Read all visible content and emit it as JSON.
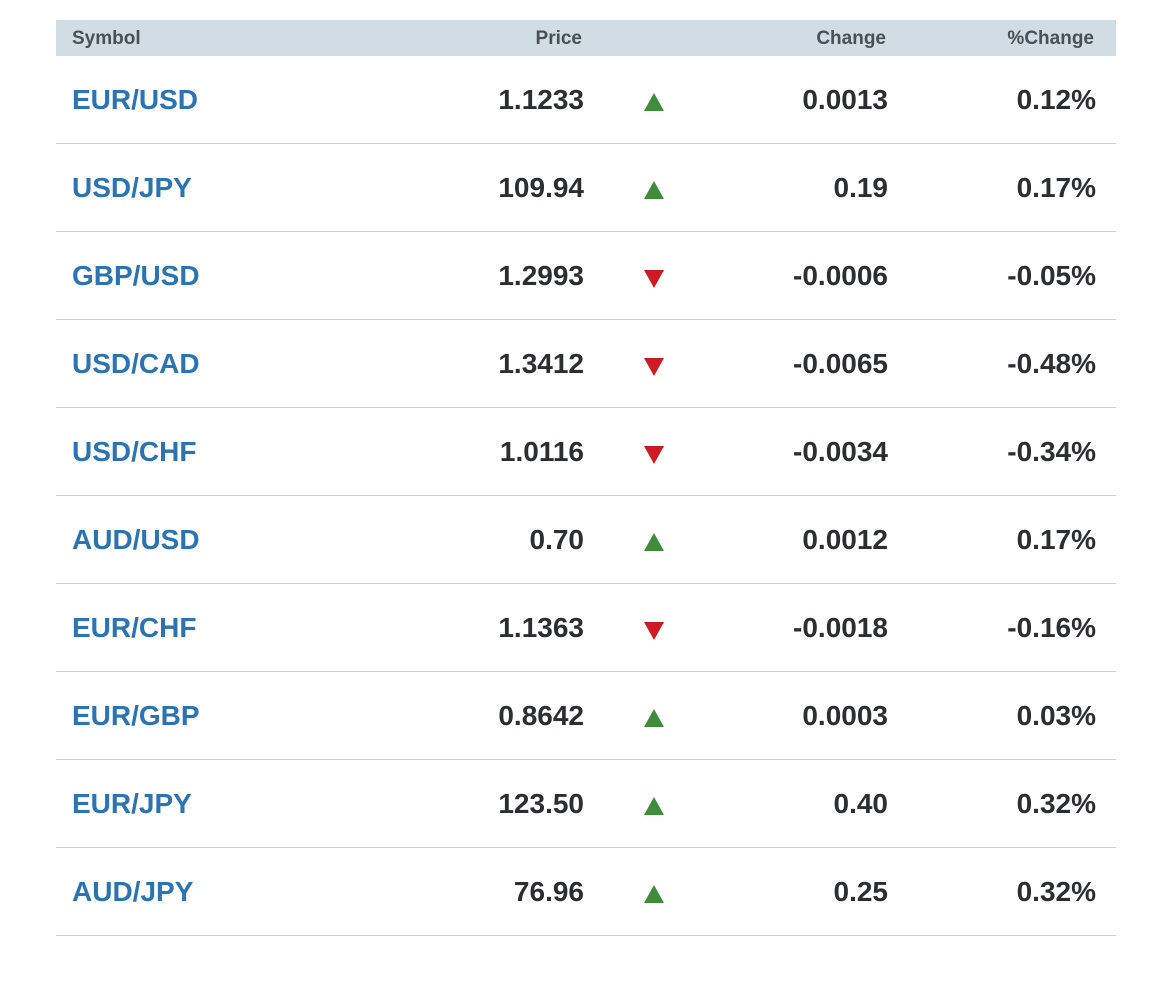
{
  "colors": {
    "header_bg": "#d1dde4",
    "symbol_link": "#2c73b4",
    "up": "#3f8d3a",
    "down": "#cc1b24",
    "divider": "#c9d3d9"
  },
  "header": {
    "symbol": "Symbol",
    "price": "Price",
    "change": "Change",
    "pct_change": "%Change"
  },
  "rows": [
    {
      "symbol": "EUR/USD",
      "price": "1.1233",
      "direction": "up",
      "change": "0.0013",
      "pct_change": "0.12%"
    },
    {
      "symbol": "USD/JPY",
      "price": "109.94",
      "direction": "up",
      "change": "0.19",
      "pct_change": "0.17%"
    },
    {
      "symbol": "GBP/USD",
      "price": "1.2993",
      "direction": "down",
      "change": "-0.0006",
      "pct_change": "-0.05%"
    },
    {
      "symbol": "USD/CAD",
      "price": "1.3412",
      "direction": "down",
      "change": "-0.0065",
      "pct_change": "-0.48%"
    },
    {
      "symbol": "USD/CHF",
      "price": "1.0116",
      "direction": "down",
      "change": "-0.0034",
      "pct_change": "-0.34%"
    },
    {
      "symbol": "AUD/USD",
      "price": "0.70",
      "direction": "up",
      "change": "0.0012",
      "pct_change": "0.17%"
    },
    {
      "symbol": "EUR/CHF",
      "price": "1.1363",
      "direction": "down",
      "change": "-0.0018",
      "pct_change": "-0.16%"
    },
    {
      "symbol": "EUR/GBP",
      "price": "0.8642",
      "direction": "up",
      "change": "0.0003",
      "pct_change": "0.03%"
    },
    {
      "symbol": "EUR/JPY",
      "price": "123.50",
      "direction": "up",
      "change": "0.40",
      "pct_change": "0.32%"
    },
    {
      "symbol": "AUD/JPY",
      "price": "76.96",
      "direction": "up",
      "change": "0.25",
      "pct_change": "0.32%"
    }
  ]
}
